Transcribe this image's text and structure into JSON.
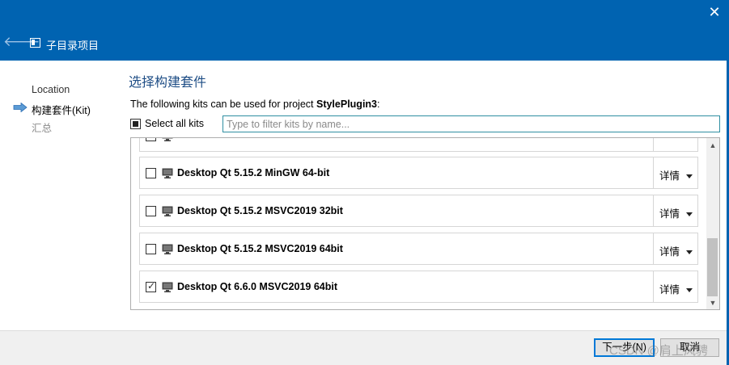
{
  "window": {
    "title": "子目录项目",
    "close_glyph": "✕",
    "back_glyph": "🡐"
  },
  "steps": [
    {
      "label": "Location",
      "state": "done"
    },
    {
      "label": "构建套件(Kit)",
      "state": "current"
    },
    {
      "label": "汇总",
      "state": "pending"
    }
  ],
  "page": {
    "title": "选择构建套件",
    "description_prefix": "The following kits can be used for project ",
    "project_name": "StylePlugin3",
    "description_suffix": ":",
    "select_all_label": "Select all kits",
    "filter_placeholder": "Type to filter kits by name..."
  },
  "kits": [
    {
      "name": "Desktop Qt 5.15.2 MinGW 64-bit",
      "checked": false,
      "details": "详情"
    },
    {
      "name": "Desktop Qt 5.15.2 MSVC2019 32bit",
      "checked": false,
      "details": "详情"
    },
    {
      "name": "Desktop Qt 5.15.2 MSVC2019 64bit",
      "checked": false,
      "details": "详情"
    },
    {
      "name": "Desktop Qt 6.6.0 MSVC2019 64bit",
      "checked": true,
      "details": "详情"
    }
  ],
  "buttons": {
    "next": "下一步(N)",
    "cancel": "取消"
  },
  "watermark": "CSDN @肩上风骋",
  "colors": {
    "titlebar": "#0063b1",
    "accent": "#0078d7",
    "step_arrow": "#5b9bd5"
  }
}
